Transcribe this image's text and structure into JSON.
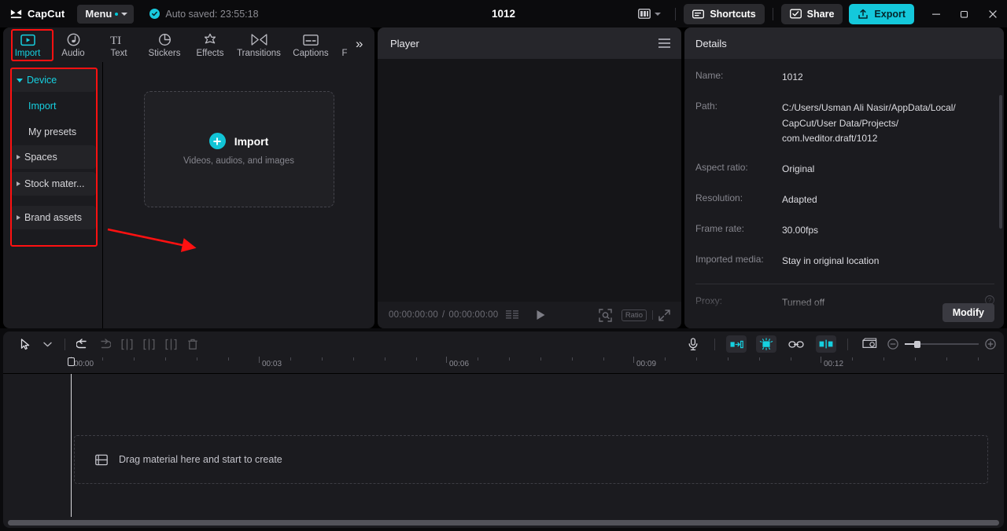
{
  "titlebar": {
    "brand": "CapCut",
    "menu_label": "Menu",
    "autosave": "Auto saved: 23:55:18",
    "project_title": "1012",
    "shortcuts_label": "Shortcuts",
    "share_label": "Share",
    "export_label": "Export",
    "icons": {
      "logo": "capcut-logo-icon",
      "check": "check-circle-icon",
      "layout": "layout-panels-icon",
      "shortcuts": "keyboard-icon",
      "share": "share-icon",
      "export": "upload-icon",
      "minimize": "minimize-icon",
      "maximize": "restore-icon",
      "close": "close-icon"
    },
    "accent": "#14c8db"
  },
  "left_panel": {
    "tabs": [
      {
        "label": "Import",
        "icon": "import-video-icon",
        "active": true
      },
      {
        "label": "Audio",
        "icon": "audio-note-icon",
        "active": false
      },
      {
        "label": "Text",
        "icon": "text-ti-icon",
        "active": false
      },
      {
        "label": "Stickers",
        "icon": "sticker-icon",
        "active": false
      },
      {
        "label": "Effects",
        "icon": "effects-star-icon",
        "active": false
      },
      {
        "label": "Transitions",
        "icon": "transitions-icon",
        "active": false
      },
      {
        "label": "Captions",
        "icon": "captions-icon",
        "active": false
      }
    ],
    "tab_truncated": "F",
    "overflow_icon": "double-chevron-right-icon",
    "nav": [
      {
        "label": "Device",
        "type": "group",
        "expanded": true,
        "selected": true
      },
      {
        "label": "Import",
        "type": "sub",
        "selected": true
      },
      {
        "label": "My presets",
        "type": "sub",
        "selected": false
      },
      {
        "label": "Spaces",
        "type": "group",
        "expanded": false,
        "selected": false
      },
      {
        "label": "Stock mater...",
        "type": "group",
        "expanded": false,
        "selected": false
      },
      {
        "label": "Brand assets",
        "type": "group",
        "expanded": false,
        "selected": false
      }
    ],
    "dropzone": {
      "title": "Import",
      "subtitle": "Videos, audios, and images",
      "icon": "plus-circle-icon"
    },
    "highlight_color": "#ff1111"
  },
  "player": {
    "title": "Player",
    "menu_icon": "hamburger-menu-icon",
    "current_time": "00:00:00:00",
    "total_time": "00:00:00:00",
    "separator": "/",
    "ratio_label": "Ratio",
    "icons": {
      "frames": "frames-list-icon",
      "play": "play-icon",
      "zoom_fit": "zoom-fit-icon",
      "fullscreen": "fullscreen-icon"
    }
  },
  "details": {
    "header": "Details",
    "rows": [
      {
        "key": "Name:",
        "value": "1012"
      },
      {
        "key": "Path:",
        "value": "C:/Users/Usman Ali Nasir/AppData/Local/\nCapCut/User Data/Projects/\ncom.lveditor.draft/1012"
      },
      {
        "key": "Aspect ratio:",
        "value": "Original"
      },
      {
        "key": "Resolution:",
        "value": "Adapted"
      },
      {
        "key": "Frame rate:",
        "value": "30.00fps"
      },
      {
        "key": "Imported media:",
        "value": "Stay in original location"
      }
    ],
    "proxy": {
      "key": "Proxy:",
      "value": "Turned off",
      "help_icon": "help-circle-icon"
    },
    "modify_label": "Modify"
  },
  "timeline": {
    "tools": [
      {
        "name": "select-cursor",
        "icon": "cursor-arrow-icon",
        "enabled": true
      },
      {
        "name": "tool-dropdown",
        "icon": "chevron-down-icon",
        "enabled": true
      },
      {
        "name": "undo",
        "icon": "undo-icon",
        "enabled": true
      },
      {
        "name": "redo",
        "icon": "redo-icon",
        "enabled": false
      },
      {
        "name": "split",
        "icon": "split-icon",
        "enabled": false
      },
      {
        "name": "trim-left",
        "icon": "trim-left-icon",
        "enabled": false
      },
      {
        "name": "trim-right",
        "icon": "trim-right-icon",
        "enabled": false
      },
      {
        "name": "delete",
        "icon": "trash-icon",
        "enabled": false
      }
    ],
    "right_tools": [
      {
        "name": "record-voiceover",
        "icon": "microphone-icon",
        "active": false
      },
      {
        "name": "auto-fill",
        "icon": "fill-gap-icon",
        "active": true
      },
      {
        "name": "magnetic-snap",
        "icon": "magnet-snap-icon",
        "active": true
      },
      {
        "name": "link-audio-video",
        "icon": "link-icon",
        "active": false
      },
      {
        "name": "auto-adsorption",
        "icon": "adsorption-icon",
        "active": true
      },
      {
        "name": "preview-mode",
        "icon": "preview-window-icon",
        "active": false
      }
    ],
    "zoom": {
      "out_icon": "zoom-out-icon",
      "in_icon": "zoom-in-icon",
      "value": 12
    },
    "ruler_labels": [
      "00:00",
      "00:03",
      "00:06",
      "00:09",
      "00:12"
    ],
    "drop_hint": "Drag material here and start to create",
    "drop_icon": "filmstrip-icon"
  }
}
